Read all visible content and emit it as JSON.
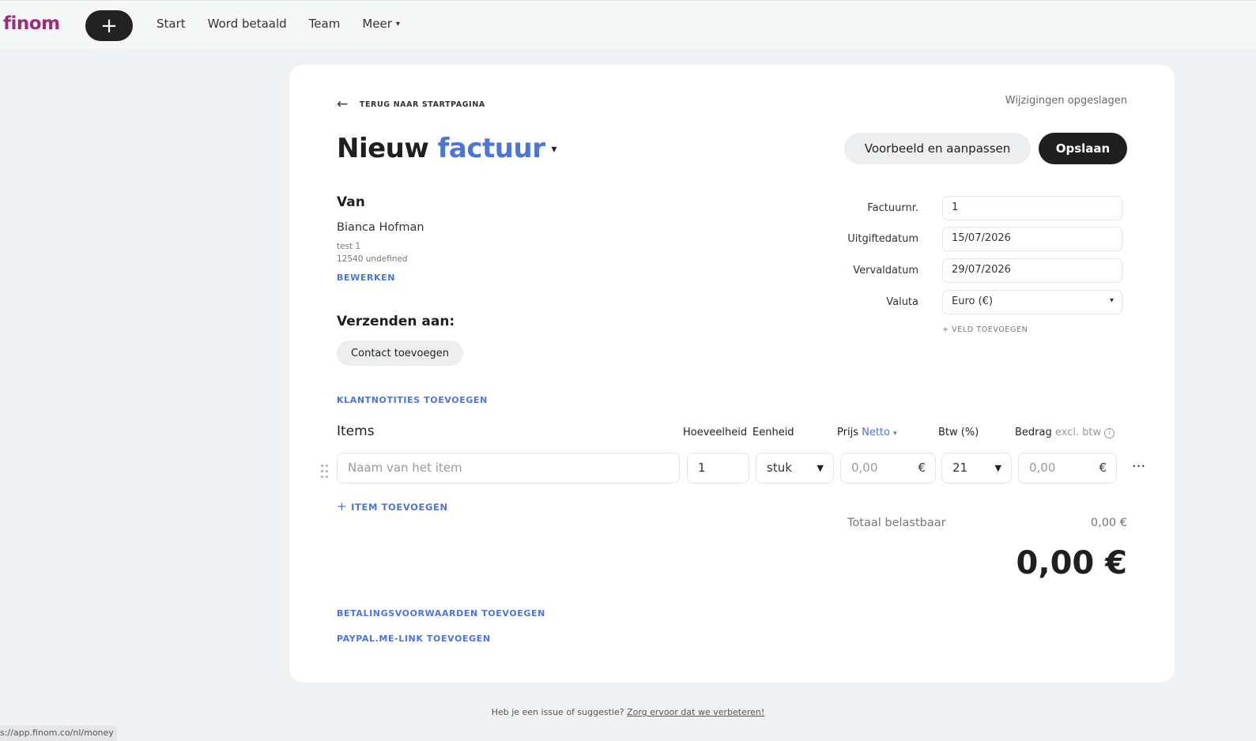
{
  "topbar": {
    "logo": "finom",
    "add_label": "+",
    "nav": [
      "Start",
      "Word betaald",
      "Team",
      "Meer"
    ],
    "more_chevron": "⌄"
  },
  "invoice": {
    "back_label": "TERUG NAAR STARTPAGINA",
    "saved_status": "Wijzigingen opgeslagen",
    "title_prefix": "Nieuw",
    "title_type": "factuur",
    "preview_label": "Voorbeeld en aanpassen",
    "save_label": "Opslaan",
    "from": {
      "heading": "Van",
      "name": "Bianca Hofman",
      "address_line1": "test 1",
      "address_line2": "12540 undefined",
      "edit_label": "BEWERKEN"
    },
    "send_to": {
      "heading": "Verzenden aan:",
      "add_contact_label": "Contact toevoegen"
    },
    "fields": [
      {
        "label": "Factuurnr.",
        "value": "1"
      },
      {
        "label": "Uitgiftedatum",
        "value": "15/07/2026"
      },
      {
        "label": "Vervaldatum",
        "value": "29/07/2026"
      },
      {
        "label": "Valuta",
        "value": "Euro (€)"
      }
    ],
    "add_field_label": "+ VELD TOEVOEGEN",
    "customer_notes_label": "KLANTNOTITIES TOEVOEGEN",
    "items": {
      "heading": "Items",
      "col_quantity": "Hoeveelheid",
      "col_unit": "Eenheid",
      "col_price": "Prijs",
      "col_price_mode": "Netto",
      "col_vat": "Btw (%)",
      "col_amount": "Bedrag",
      "col_amount_note": "excl. btw",
      "row": {
        "name_placeholder": "Naam van het item",
        "quantity": "1",
        "unit": "stuk",
        "price_placeholder": "0,00",
        "currency": "€",
        "vat": "21",
        "amount_placeholder": "0,00"
      },
      "add_item_label": "ITEM TOEVOEGEN"
    },
    "totals": {
      "taxable_label": "Totaal belastbaar",
      "taxable_value": "0,00 €",
      "grand_total": "0,00 €"
    },
    "payment_terms_label": "BETALINGSVOORWAARDEN TOEVOEGEN",
    "paypal_label": "PAYPAL.ME-LINK TOEVOEGEN"
  },
  "footer": {
    "text": "Heb je een issue of suggestie?",
    "link": "Zorg ervoor dat we verbeteren!"
  },
  "status_bar": {
    "url": "s://app.finom.co/nl/money"
  },
  "colors": {
    "accent": "#4b74dd",
    "brand": "#9c2d7a",
    "dark_button": "#1f1f1f"
  }
}
